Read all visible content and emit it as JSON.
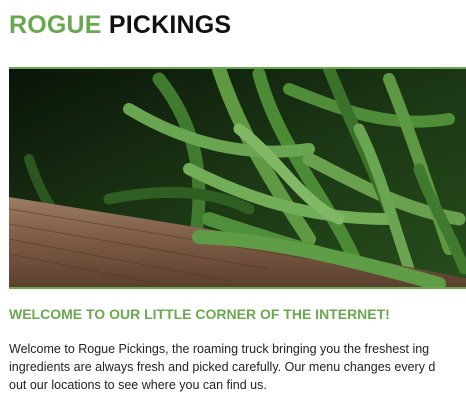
{
  "header": {
    "title_part1": "ROGUE",
    "title_part2": "PICKINGS"
  },
  "colors": {
    "brand_green": "#6aa84f",
    "title_dark": "#111111"
  },
  "hero": {
    "image_icon": "green-beans-photo"
  },
  "welcome": {
    "heading": "WELCOME TO OUR LITTLE CORNER OF THE INTERNET!",
    "paragraph_lines": [
      "Welcome to Rogue Pickings, the roaming truck bringing you the freshest ing",
      "ingredients are always fresh and picked carefully. Our menu changes every d",
      "out our locations to see where you can find us."
    ]
  }
}
